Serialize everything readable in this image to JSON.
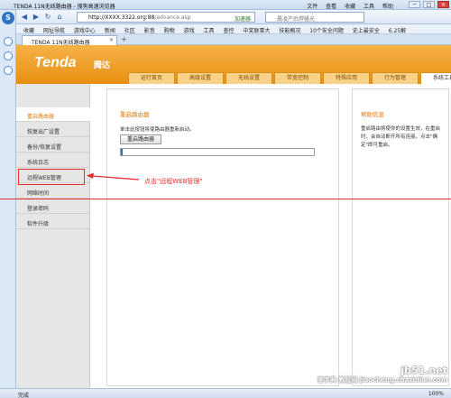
{
  "window": {
    "title": "TENDA 11N无线路由器 - 搜狗高速浏览器",
    "menu": [
      "文件",
      "查看",
      "收藏",
      "工具",
      "帮助"
    ],
    "controls": [
      "─",
      "□",
      "✕"
    ]
  },
  "toolbar": {
    "url_host": "http://XXXX.3322.org:88",
    "url_path": "/advance.asp",
    "accel_label": "加速器",
    "search_placeholder": "晨凌产后焊骚光"
  },
  "favorites": [
    "收藏",
    "网址导航",
    "游戏中心",
    "新闻",
    "社区",
    "影音",
    "购物",
    "游戏",
    "工具",
    "查控",
    "中奖联事大",
    "技能概况",
    "10个安全问题",
    "史上最安全",
    "6.25解"
  ],
  "tab": {
    "label": "TENDA 11N无线路由器",
    "close": "✕",
    "new": "+"
  },
  "brand": {
    "logo": "Tenda",
    "name": "腾达"
  },
  "main_tabs": [
    {
      "label": "运行首页",
      "active": false
    },
    {
      "label": "高级设置",
      "active": false
    },
    {
      "label": "无线设置",
      "active": false
    },
    {
      "label": "带宽控制",
      "active": false
    },
    {
      "label": "特殊应用",
      "active": false
    },
    {
      "label": "行为管理",
      "active": false
    },
    {
      "label": "系统工具",
      "active": true
    }
  ],
  "sidebar": [
    {
      "label": "重启路由器",
      "active": true
    },
    {
      "label": "恢复出厂设置",
      "active": false
    },
    {
      "label": "备份/恢复设置",
      "active": false
    },
    {
      "label": "系统日志",
      "active": false
    },
    {
      "label": "远程WEB管理",
      "active": false
    },
    {
      "label": "网络时间",
      "active": false
    },
    {
      "label": "登录密码",
      "active": false
    },
    {
      "label": "软件升级",
      "active": false
    }
  ],
  "content": {
    "title": "重启路由器",
    "description": "单击此按钮将使路由器重新启动。",
    "button": "重启路由器",
    "progress": 0.01
  },
  "help": {
    "title": "帮助信息",
    "text": "重启路由将使你的设置生效，在重启时，会自动断开所有连接，点击\"确定\"即可重启。"
  },
  "annotation": {
    "text": "点击\"远程WEB管理\""
  },
  "watermark": {
    "line1": "jb51.net",
    "line2": "查字典 教程网 jiaocheng.chazidian.com"
  },
  "status": {
    "text": "完成",
    "zoom": "100%"
  },
  "colors": {
    "accent": "#e0760c",
    "header": "#f2a12c",
    "annotation": "#e23030"
  }
}
